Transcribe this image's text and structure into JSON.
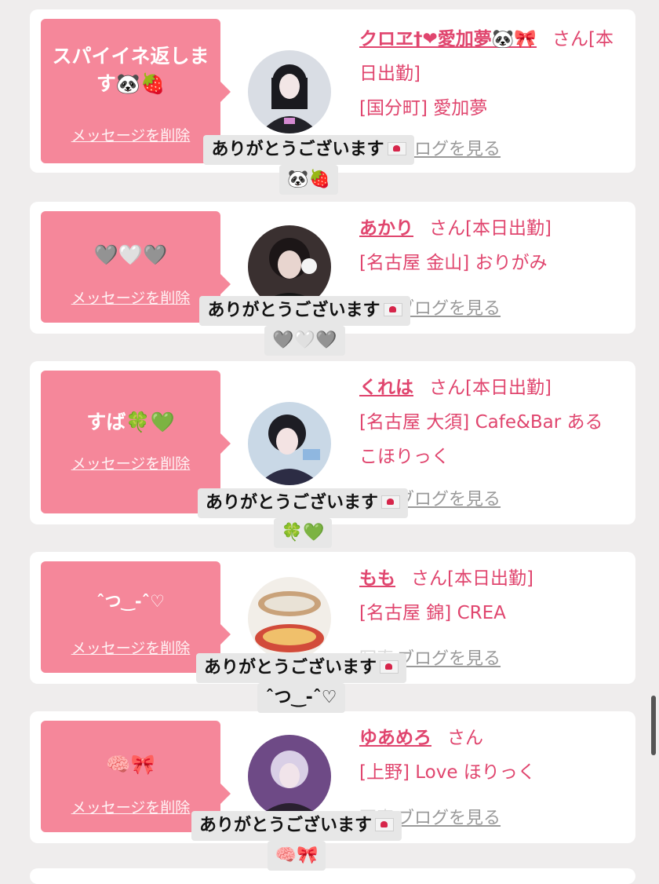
{
  "ui": {
    "delete_label": "メッセージを削除",
    "blog_link": "ブログを見る",
    "blog_prefix": "写真",
    "thanks": "ありがとうございます"
  },
  "messages": [
    {
      "bubble": "スパイイネ返します🐼🍓",
      "name": "クロヱ†❤愛加夢🐼🎀",
      "honorific": "さん[本日出勤]",
      "location": "[国分町] 愛加夢",
      "reply_emoji": "🐼🍓"
    },
    {
      "bubble": "🩶🤍🩶",
      "name": "あかり",
      "honorific": "さん[本日出勤]",
      "location": "[名古屋 金山] おりがみ",
      "reply_emoji": "🩶🤍🩶"
    },
    {
      "bubble": "すば🍀💚",
      "name": "くれは",
      "honorific": "さん[本日出勤]",
      "location": "[名古屋 大須] Cafe&Bar あるこほりっく",
      "reply_emoji": "🍀💚"
    },
    {
      "bubble": "ˆつ‿-ˆ♡",
      "name": "もも",
      "honorific": "さん[本日出勤]",
      "location": "[名古屋 錦] CREA",
      "reply_emoji": "ˆつ‿-ˆ♡"
    },
    {
      "bubble": "🧠🎀",
      "name": "ゆあめろ",
      "honorific": "さん",
      "location": "[上野] Love ほりっく",
      "reply_emoji": "🧠🎀"
    }
  ]
}
